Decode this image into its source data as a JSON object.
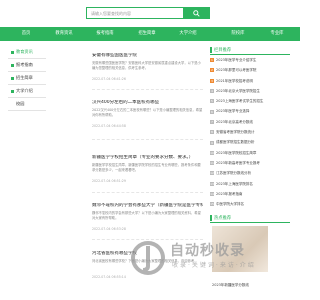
{
  "search": {
    "placeholder": "请输入您要查找的内容"
  },
  "colors": {
    "brand": "#2db45e",
    "hot": "#f08a32"
  },
  "nav": {
    "items": [
      "首页",
      "教育资讯",
      "报考指南",
      "招生简章",
      "大学介绍",
      "",
      "院校库",
      "专业库"
    ]
  },
  "sidebar": {
    "items": [
      "教育资讯",
      "报考指南",
      "招生简章",
      "大学介绍",
      "校园"
    ]
  },
  "articles": [
    {
      "title": "安徽有哪些国医医学院",
      "desc": "安徽有哪些国医医学院？安徽医科大学是安徽省属重点建设大学，以下是小编为您整理的相关信息，供考生参考。",
      "date": "2022-07-04 06:41:26"
    },
    {
      "title": "汉兴400分左右的二本医校有哪些",
      "desc": "2022汉兴400分左右的二本医校有哪些？以下是小编整理的相关信息，希望对你有所帮助。",
      "date": "2022-07-04 06:44:58"
    },
    {
      "title": "新疆医学学校招生简章（专业的要求分数、要求。）",
      "desc": "新疆医学学校招生简章，新疆医学院学校的招生专业有哪些，报考条件和要求分数是多少，一起来看看吧。",
      "date": "2022-07-04 06:51:29"
    },
    {
      "title": "魏邻不靠校内的学会有那些大学（新疆医学院是医学专科学…",
      "desc": "魏邻不靠校内的学会有那些大学？以下是小编为大家整理的相关资料，希望对大家有所帮助。",
      "date": "2022-07-04 06:53:28"
    },
    {
      "title": "河北省医校有哪些学校",
      "desc": "河北省医校有哪些学校？下面是小编为大家整理的相关信息，欢迎参考。",
      "date": "2022-07-04 06:55:14"
    }
  ],
  "right": {
    "title": "栏目推荐",
    "items": [
      "2023年医学专业介绍学生",
      "2023年那里可以考医学院",
      "2021年医学校招考说明",
      "2023年北京大学医学院招生",
      "2023上海医学考试学生的招生",
      "2023年医学专业选择",
      "2023年北京高考分数线",
      "安徽省考医学院分数统计",
      "成都医学院招生数据分析",
      "2023年医学院校招生简章",
      "2023年新高考医学专业报考",
      "江苏医学院分数线分析",
      "2023年上海医学院排名",
      "2023年报考指南",
      "中医学院大学排名"
    ],
    "tag_title": "热点推荐",
    "thumb_title": "2023年新疆医学分数线"
  },
  "watermark": {
    "main": "自动秒收录",
    "sub": "收录·关键词·来访·介绍"
  }
}
